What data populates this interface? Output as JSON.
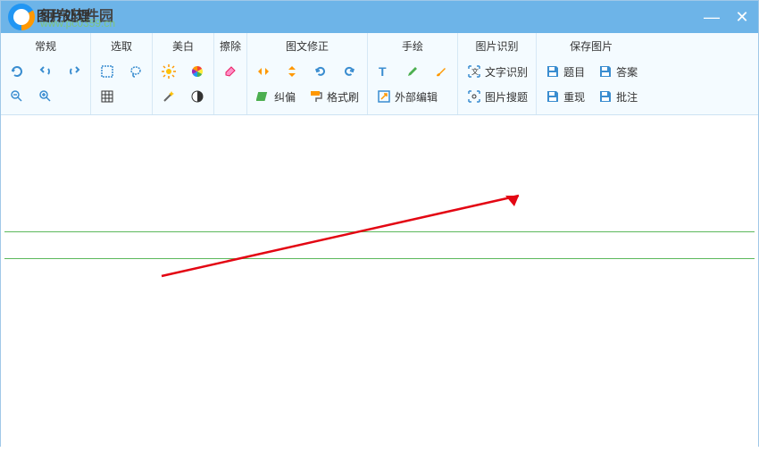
{
  "window": {
    "title": "河东软件园",
    "subtitle": "www.pc0359.cn",
    "overlay": "图片处理"
  },
  "groups": {
    "g1": {
      "title": "常规"
    },
    "g2": {
      "title": "选取"
    },
    "g3": {
      "title": "美白"
    },
    "g4": {
      "title": "擦除"
    },
    "g5": {
      "title": "图文修正",
      "btn1": "纠偏",
      "btn2": "格式刷"
    },
    "g6": {
      "title": "手绘",
      "btn1": "外部编辑"
    },
    "g7": {
      "title": "图片识别",
      "btn1": "文字识别",
      "btn2": "图片搜题"
    },
    "g8": {
      "title": "保存图片",
      "btn1": "题目",
      "btn2": "答案",
      "btn3": "重现",
      "btn4": "批注"
    }
  }
}
